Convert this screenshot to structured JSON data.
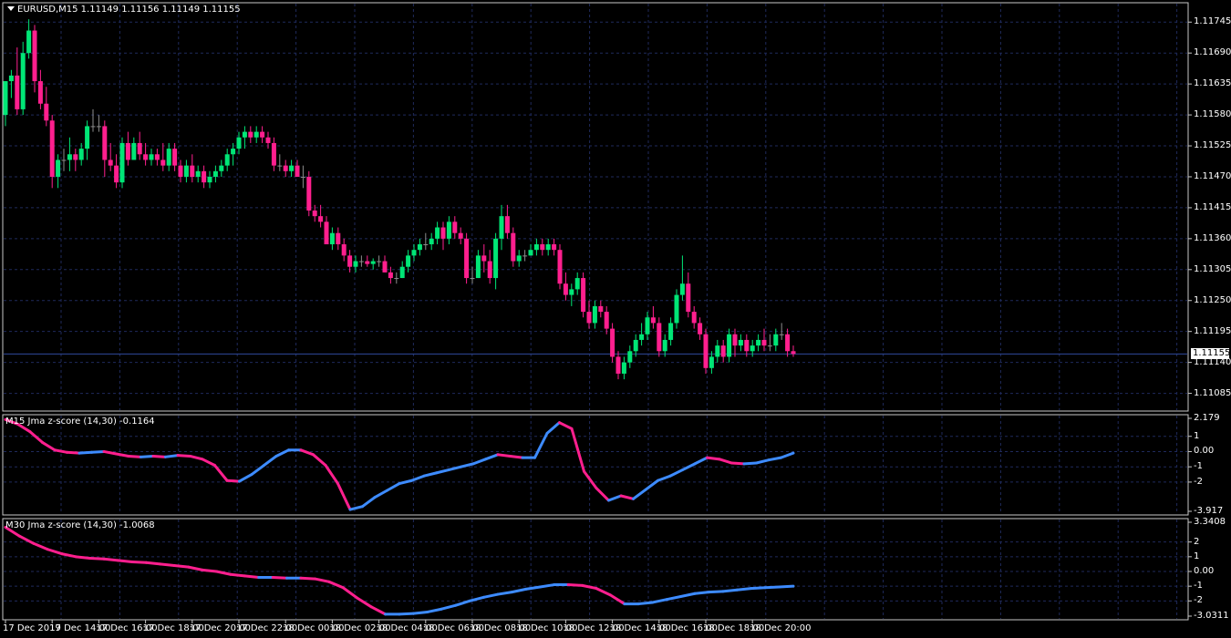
{
  "main": {
    "title": "EURUSD,M15  1.11149 1.11156 1.11149 1.11155",
    "price_min": 1.1106,
    "price_max": 1.1176,
    "price_labels": [
      "1.11745",
      "1.11690",
      "1.11635",
      "1.11580",
      "1.11525",
      "1.11470",
      "1.11415",
      "1.11360",
      "1.11305",
      "1.11250",
      "1.11195",
      "1.11140",
      "1.11085"
    ],
    "current_price": "1.11155",
    "candles": [
      [
        1.1158,
        1.1164,
        1.1156,
        1.1164
      ],
      [
        1.1164,
        1.1166,
        1.1161,
        1.1165
      ],
      [
        1.1165,
        1.117,
        1.1158,
        1.1159
      ],
      [
        1.1159,
        1.1171,
        1.1158,
        1.1169
      ],
      [
        1.1169,
        1.1175,
        1.1168,
        1.1173
      ],
      [
        1.1173,
        1.1174,
        1.1162,
        1.1164
      ],
      [
        1.1164,
        1.1166,
        1.1159,
        1.116
      ],
      [
        1.116,
        1.1163,
        1.1156,
        1.1157
      ],
      [
        1.1157,
        1.1158,
        1.1145,
        1.1147
      ],
      [
        1.1147,
        1.1151,
        1.1145,
        1.115
      ],
      [
        1.115,
        1.1152,
        1.1148,
        1.115
      ],
      [
        1.115,
        1.1154,
        1.1148,
        1.1151
      ],
      [
        1.1151,
        1.1152,
        1.1148,
        1.115
      ],
      [
        1.115,
        1.1153,
        1.1149,
        1.1152
      ],
      [
        1.1152,
        1.1157,
        1.115,
        1.1156
      ],
      [
        1.1156,
        1.1159,
        1.1155,
        1.1156
      ],
      [
        1.1156,
        1.1158,
        1.1155,
        1.1156
      ],
      [
        1.1156,
        1.1157,
        1.1147,
        1.115
      ],
      [
        1.115,
        1.1153,
        1.1148,
        1.1149
      ],
      [
        1.1149,
        1.1151,
        1.1145,
        1.1146
      ],
      [
        1.1146,
        1.1154,
        1.1145,
        1.1153
      ],
      [
        1.1153,
        1.1155,
        1.1149,
        1.115
      ],
      [
        1.115,
        1.1154,
        1.115,
        1.1153
      ],
      [
        1.1153,
        1.1155,
        1.115,
        1.1151
      ],
      [
        1.1151,
        1.1153,
        1.1149,
        1.115
      ],
      [
        1.115,
        1.1152,
        1.1149,
        1.1151
      ],
      [
        1.1151,
        1.1152,
        1.1149,
        1.115
      ],
      [
        1.115,
        1.1153,
        1.1148,
        1.1149
      ],
      [
        1.1149,
        1.1153,
        1.1148,
        1.1152
      ],
      [
        1.1152,
        1.1153,
        1.1148,
        1.1149
      ],
      [
        1.1149,
        1.115,
        1.1146,
        1.1147
      ],
      [
        1.1147,
        1.115,
        1.1146,
        1.1149
      ],
      [
        1.1149,
        1.1151,
        1.1146,
        1.1147
      ],
      [
        1.1147,
        1.1149,
        1.1146,
        1.1148
      ],
      [
        1.1148,
        1.1149,
        1.1145,
        1.1146
      ],
      [
        1.1146,
        1.1148,
        1.1145,
        1.1147
      ],
      [
        1.1147,
        1.1149,
        1.1146,
        1.1148
      ],
      [
        1.1148,
        1.115,
        1.1147,
        1.1149
      ],
      [
        1.1149,
        1.1152,
        1.1148,
        1.1151
      ],
      [
        1.1151,
        1.1153,
        1.1149,
        1.1152
      ],
      [
        1.1152,
        1.1155,
        1.1151,
        1.1154
      ],
      [
        1.1154,
        1.1156,
        1.1152,
        1.1155
      ],
      [
        1.1155,
        1.1156,
        1.1153,
        1.1154
      ],
      [
        1.1154,
        1.1156,
        1.1153,
        1.1155
      ],
      [
        1.1155,
        1.1156,
        1.1153,
        1.1154
      ],
      [
        1.1154,
        1.1155,
        1.1152,
        1.1153
      ],
      [
        1.1153,
        1.1154,
        1.1148,
        1.1149
      ],
      [
        1.1149,
        1.1151,
        1.1148,
        1.1149
      ],
      [
        1.1149,
        1.115,
        1.1147,
        1.1148
      ],
      [
        1.1148,
        1.115,
        1.1147,
        1.1149
      ],
      [
        1.1149,
        1.115,
        1.1147,
        1.1147
      ],
      [
        1.1147,
        1.1149,
        1.1145,
        1.1147
      ],
      [
        1.1147,
        1.1148,
        1.114,
        1.1141
      ],
      [
        1.1141,
        1.1142,
        1.1139,
        1.114
      ],
      [
        1.114,
        1.1142,
        1.1138,
        1.1139
      ],
      [
        1.1139,
        1.114,
        1.1135,
        1.1135
      ],
      [
        1.1135,
        1.1138,
        1.1134,
        1.1137
      ],
      [
        1.1137,
        1.1138,
        1.1134,
        1.1135
      ],
      [
        1.1135,
        1.1136,
        1.1132,
        1.1133
      ],
      [
        1.1133,
        1.1134,
        1.113,
        1.1131
      ],
      [
        1.1131,
        1.1133,
        1.113,
        1.1132
      ],
      [
        1.1132,
        1.1133,
        1.1131,
        1.1132
      ],
      [
        1.1132,
        1.1133,
        1.1131,
        1.11315
      ],
      [
        1.11315,
        1.11325,
        1.11305,
        1.1132
      ],
      [
        1.1132,
        1.1133,
        1.1131,
        1.1132
      ],
      [
        1.1132,
        1.1133,
        1.113,
        1.113
      ],
      [
        1.113,
        1.1131,
        1.1128,
        1.1129
      ],
      [
        1.1129,
        1.113,
        1.1128,
        1.1129
      ],
      [
        1.1129,
        1.1132,
        1.1129,
        1.1131
      ],
      [
        1.1131,
        1.1134,
        1.113,
        1.1133
      ],
      [
        1.1133,
        1.1135,
        1.1132,
        1.1134
      ],
      [
        1.1134,
        1.1136,
        1.1133,
        1.1135
      ],
      [
        1.1135,
        1.1137,
        1.1134,
        1.1135
      ],
      [
        1.1135,
        1.1137,
        1.1134,
        1.1136
      ],
      [
        1.1136,
        1.1139,
        1.1135,
        1.1138
      ],
      [
        1.1138,
        1.1139,
        1.1134,
        1.1136
      ],
      [
        1.1136,
        1.114,
        1.1135,
        1.1139
      ],
      [
        1.1139,
        1.114,
        1.1136,
        1.1137
      ],
      [
        1.1137,
        1.1138,
        1.1135,
        1.1136
      ],
      [
        1.1136,
        1.1137,
        1.1128,
        1.1129
      ],
      [
        1.1129,
        1.1131,
        1.1128,
        1.1129
      ],
      [
        1.1129,
        1.1134,
        1.1129,
        1.1133
      ],
      [
        1.1133,
        1.1135,
        1.113,
        1.1132
      ],
      [
        1.1132,
        1.1134,
        1.1128,
        1.1129
      ],
      [
        1.1129,
        1.1137,
        1.1127,
        1.1136
      ],
      [
        1.1136,
        1.1142,
        1.1134,
        1.114
      ],
      [
        1.114,
        1.1142,
        1.1136,
        1.1137
      ],
      [
        1.1137,
        1.1138,
        1.1131,
        1.1132
      ],
      [
        1.1132,
        1.1134,
        1.1131,
        1.1133
      ],
      [
        1.1133,
        1.1134,
        1.1132,
        1.1133
      ],
      [
        1.1133,
        1.1135,
        1.1133,
        1.1134
      ],
      [
        1.1134,
        1.1136,
        1.1133,
        1.1135
      ],
      [
        1.1135,
        1.1136,
        1.1133,
        1.1134
      ],
      [
        1.1134,
        1.1136,
        1.1133,
        1.1135
      ],
      [
        1.1135,
        1.1136,
        1.1133,
        1.1134
      ],
      [
        1.1134,
        1.1135,
        1.1127,
        1.1128
      ],
      [
        1.1128,
        1.113,
        1.1125,
        1.1126
      ],
      [
        1.1126,
        1.1128,
        1.1124,
        1.1127
      ],
      [
        1.1127,
        1.113,
        1.1126,
        1.1129
      ],
      [
        1.1129,
        1.113,
        1.1122,
        1.1123
      ],
      [
        1.1123,
        1.1125,
        1.112,
        1.1121
      ],
      [
        1.1121,
        1.1125,
        1.112,
        1.1124
      ],
      [
        1.1124,
        1.1125,
        1.1122,
        1.1123
      ],
      [
        1.1123,
        1.1124,
        1.1119,
        1.112
      ],
      [
        1.112,
        1.1121,
        1.1114,
        1.1115
      ],
      [
        1.1115,
        1.1116,
        1.1111,
        1.1112
      ],
      [
        1.1112,
        1.1115,
        1.1111,
        1.1114
      ],
      [
        1.1114,
        1.1117,
        1.1113,
        1.1116
      ],
      [
        1.1116,
        1.1119,
        1.1115,
        1.1118
      ],
      [
        1.1118,
        1.1121,
        1.1117,
        1.1119
      ],
      [
        1.1119,
        1.1123,
        1.1118,
        1.1122
      ],
      [
        1.1122,
        1.1124,
        1.112,
        1.1121
      ],
      [
        1.1121,
        1.1122,
        1.1115,
        1.1116
      ],
      [
        1.1116,
        1.1119,
        1.1115,
        1.1118
      ],
      [
        1.1118,
        1.1122,
        1.1117,
        1.1121
      ],
      [
        1.1121,
        1.1127,
        1.112,
        1.1126
      ],
      [
        1.1126,
        1.1133,
        1.1125,
        1.1128
      ],
      [
        1.1128,
        1.113,
        1.1122,
        1.1123
      ],
      [
        1.1123,
        1.1124,
        1.112,
        1.1121
      ],
      [
        1.1121,
        1.1122,
        1.1118,
        1.1119
      ],
      [
        1.1119,
        1.112,
        1.1112,
        1.1113
      ],
      [
        1.1113,
        1.1116,
        1.1112,
        1.1115
      ],
      [
        1.1115,
        1.1118,
        1.1114,
        1.1117
      ],
      [
        1.1117,
        1.1118,
        1.1114,
        1.1115
      ],
      [
        1.1115,
        1.112,
        1.1114,
        1.1119
      ],
      [
        1.1119,
        1.112,
        1.1115,
        1.1117
      ],
      [
        1.1117,
        1.1119,
        1.1116,
        1.1118
      ],
      [
        1.1118,
        1.1119,
        1.1115,
        1.1116
      ],
      [
        1.1116,
        1.1118,
        1.1115,
        1.1117
      ],
      [
        1.1117,
        1.1119,
        1.1116,
        1.1118
      ],
      [
        1.1118,
        1.112,
        1.1116,
        1.1117
      ],
      [
        1.1117,
        1.1119,
        1.1116,
        1.1117
      ],
      [
        1.1117,
        1.112,
        1.1116,
        1.1119
      ],
      [
        1.1119,
        1.1121,
        1.1118,
        1.1119
      ],
      [
        1.1119,
        1.112,
        1.1115,
        1.1116
      ],
      [
        1.1116,
        1.1117,
        1.1115,
        1.11155
      ]
    ]
  },
  "sub1": {
    "title": "M15 Jma z-score (14,30) -0.1164",
    "min": -3.917,
    "max": 2.179,
    "labels": [
      {
        "v": 2.179,
        "t": "2.179"
      },
      {
        "v": 1,
        "t": "1"
      },
      {
        "v": 0,
        "t": "0.00"
      },
      {
        "v": -1,
        "t": "-1"
      },
      {
        "v": -2,
        "t": "-2"
      },
      {
        "v": -3.917,
        "t": "-3.917"
      }
    ],
    "values": [
      2.1,
      1.8,
      1.3,
      0.6,
      0.1,
      -0.05,
      -0.1,
      -0.05,
      0.0,
      -0.15,
      -0.3,
      -0.35,
      -0.3,
      -0.35,
      -0.25,
      -0.3,
      -0.5,
      -0.9,
      -1.9,
      -1.95,
      -1.5,
      -0.9,
      -0.3,
      0.1,
      0.1,
      -0.2,
      -0.9,
      -2.1,
      -3.8,
      -3.6,
      -3.0,
      -2.55,
      -2.1,
      -1.9,
      -1.6,
      -1.4,
      -1.2,
      -1.0,
      -0.8,
      -0.5,
      -0.2,
      -0.3,
      -0.4,
      -0.4,
      1.2,
      1.9,
      1.5,
      -1.3,
      -2.4,
      -3.2,
      -2.9,
      -3.1,
      -2.5,
      -1.9,
      -1.6,
      -1.2,
      -0.8,
      -0.4,
      -0.5,
      -0.75,
      -0.8,
      -0.75,
      -0.55,
      -0.4,
      -0.1
    ]
  },
  "sub2": {
    "title": "M30 Jma z-score (14,30) -1.0068",
    "min": -3.0311,
    "max": 3.3408,
    "labels": [
      {
        "v": 3.3408,
        "t": "3.3408"
      },
      {
        "v": 2,
        "t": "2"
      },
      {
        "v": 1,
        "t": "1"
      },
      {
        "v": 0,
        "t": "0.00"
      },
      {
        "v": -1,
        "t": "-1"
      },
      {
        "v": -2,
        "t": "-2"
      },
      {
        "v": -3.0311,
        "t": "-3.0311"
      }
    ],
    "values": [
      3.0,
      2.4,
      1.9,
      1.5,
      1.2,
      1.0,
      0.9,
      0.85,
      0.75,
      0.65,
      0.6,
      0.5,
      0.4,
      0.3,
      0.1,
      0.0,
      -0.2,
      -0.3,
      -0.4,
      -0.4,
      -0.45,
      -0.45,
      -0.5,
      -0.7,
      -1.1,
      -1.8,
      -2.4,
      -2.9,
      -2.9,
      -2.85,
      -2.75,
      -2.55,
      -2.3,
      -2.0,
      -1.75,
      -1.55,
      -1.4,
      -1.2,
      -1.05,
      -0.9,
      -0.9,
      -0.95,
      -1.15,
      -1.6,
      -2.2,
      -2.2,
      -2.1,
      -1.9,
      -1.7,
      -1.5,
      -1.4,
      -1.35,
      -1.25,
      -1.15,
      -1.1,
      -1.05,
      -1.0
    ]
  },
  "time_labels": [
    {
      "i": 0,
      "t": "17 Dec 2019"
    },
    {
      "i": 8,
      "t": "17 Dec 14:00"
    },
    {
      "i": 16,
      "t": "17 Dec 16:00"
    },
    {
      "i": 24,
      "t": "17 Dec 18:00"
    },
    {
      "i": 32,
      "t": "17 Dec 20:00"
    },
    {
      "i": 40,
      "t": "17 Dec 22:00"
    },
    {
      "i": 48,
      "t": "18 Dec 00:00"
    },
    {
      "i": 56,
      "t": "18 Dec 02:00"
    },
    {
      "i": 64,
      "t": "18 Dec 04:00"
    },
    {
      "i": 72,
      "t": "18 Dec 06:00"
    },
    {
      "i": 80,
      "t": "18 Dec 08:00"
    },
    {
      "i": 88,
      "t": "18 Dec 10:00"
    },
    {
      "i": 96,
      "t": "18 Dec 12:00"
    },
    {
      "i": 104,
      "t": "18 Dec 14:00"
    },
    {
      "i": 112,
      "t": "18 Dec 16:00"
    },
    {
      "i": 120,
      "t": "18 Dec 18:00"
    },
    {
      "i": 128,
      "t": "18 Dec 20:00"
    }
  ],
  "colors": {
    "background": "#000000",
    "grid": "#1f2a5c",
    "border": "#c8c8c8",
    "bull": "#00e676",
    "bear": "#ff1f8e",
    "doji": "#8c8c8c",
    "line_up": "#3d8bff",
    "line_down": "#ff1f8e",
    "price_line": "#2f4a9c"
  }
}
